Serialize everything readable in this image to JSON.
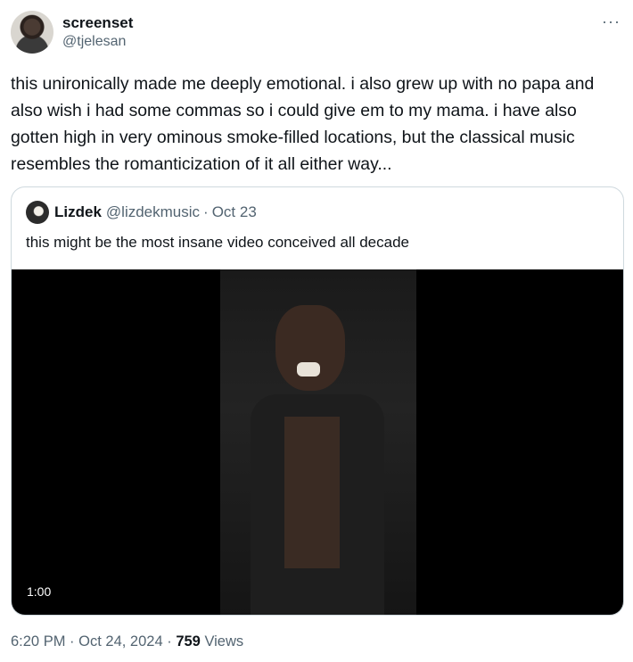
{
  "author": {
    "name": "screenset",
    "handle": "@tjelesan"
  },
  "more_icon": "more-horizontal-icon",
  "tweet": {
    "text": "this unironically made me deeply emotional. i also grew up with no papa and also wish i had some commas so i could give em to my mama. i have also gotten high in very ominous smoke-filled locations, but the classical music resembles the romanticization of it all either way..."
  },
  "quote": {
    "name": "Lizdek",
    "handle": "@lizdekmusic",
    "separator": "·",
    "date": "Oct 23",
    "text": "this might be the most insane video conceived all decade",
    "video": {
      "duration": "1:00"
    }
  },
  "meta": {
    "time": "6:20 PM",
    "separator": "·",
    "date": "Oct 24, 2024",
    "separator2": "·",
    "views_count": "759",
    "views_label": "Views"
  },
  "colors": {
    "text_primary": "#0f1419",
    "text_secondary": "#536471",
    "border": "#cfd9de"
  }
}
